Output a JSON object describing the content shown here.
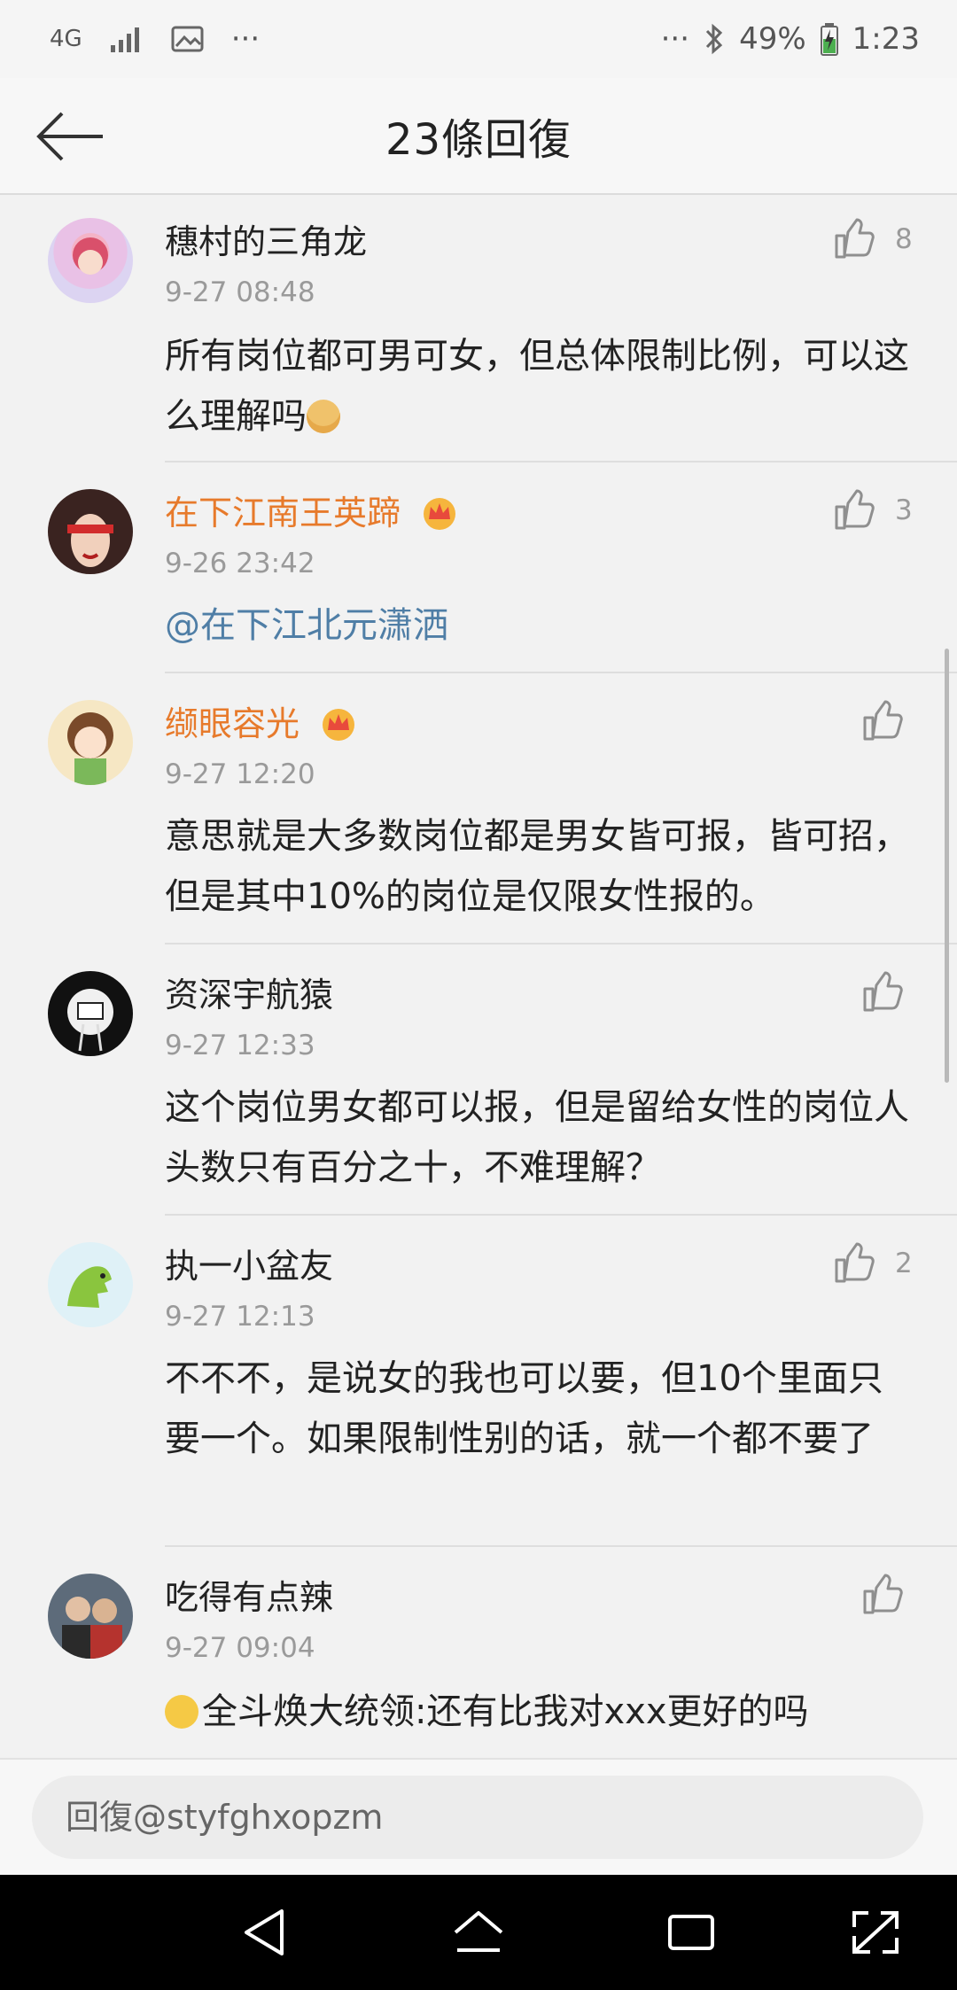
{
  "status": {
    "network": "4G",
    "dots_left": "···",
    "dots_right": "···",
    "battery": "49%",
    "time": "1:23"
  },
  "header": {
    "title": "23條回復"
  },
  "comments": [
    {
      "name": "穗村的三角龙",
      "vip": false,
      "time": "9-27 08:48",
      "content": "所有岗位都可男可女，但总体限制比例，可以这么理解吗",
      "likes": "8",
      "emoji": "doge"
    },
    {
      "name": "在下江南王英蹄",
      "vip": true,
      "time": "9-26 23:42",
      "content": "@在下江北元潇洒",
      "likes": "3"
    },
    {
      "name": "缬眼容光",
      "vip": true,
      "time": "9-27 12:20",
      "content": "意思就是大多数岗位都是男女皆可报，皆可招，但是其中10%的岗位是仅限女性报的。",
      "likes": ""
    },
    {
      "name": "资深宇航猿",
      "vip": false,
      "time": "9-27 12:33",
      "content": "这个岗位男女都可以报，但是留给女性的岗位人头数只有百分之十，不难理解？",
      "likes": ""
    },
    {
      "name": "执一小盆友",
      "vip": false,
      "time": "9-27 12:13",
      "content": "不不不，是说女的我也可以要，但10个里面只要一个。如果限制性别的话，就一个都不要了",
      "likes": "2"
    },
    {
      "name": "吃得有点辣",
      "vip": false,
      "time": "9-27 09:04",
      "content": "全斗焕大统领:还有比我对xxx更好的吗",
      "likes": "",
      "emoji": "smirk"
    }
  ],
  "reply": {
    "placeholder": "回復@styfghxopzm"
  },
  "colors": {
    "vip_name": "#e77a2b",
    "mention": "#4f7ea6",
    "meta": "#9a9a9a"
  }
}
